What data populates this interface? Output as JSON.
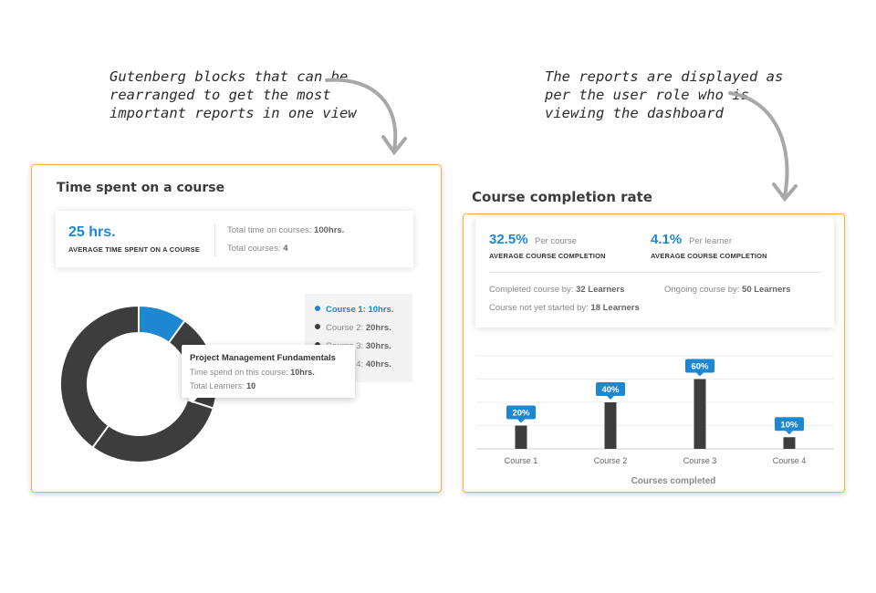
{
  "annotations": {
    "left": "Gutenberg blocks that can be\nrearranged to get the most\nimportant reports in one view",
    "right": "The reports are displayed as\nper the user role who is\nviewing the dashboard"
  },
  "time_card": {
    "title": "Time spent on a course",
    "avg_value": "25 hrs.",
    "avg_caption": "AVERAGE TIME SPENT ON A COURSE",
    "total_time_label": "Total time on courses:",
    "total_time_value": "100hrs.",
    "total_courses_label": "Total courses:",
    "total_courses_value": "4",
    "legend": [
      {
        "label": "Course 1:",
        "value": "10hrs.",
        "active": true
      },
      {
        "label": "Course 2:",
        "value": "20hrs."
      },
      {
        "label": "Course 3:",
        "value": "30hrs."
      },
      {
        "label": "Course 4:",
        "value": "40hrs."
      }
    ],
    "tooltip": {
      "title": "Project Management Fundamentals",
      "line1_label": "Time spend on this course:",
      "line1_value": "10hrs.",
      "line2_label": "Total Learners:",
      "line2_value": "10"
    },
    "donut": {
      "values": [
        10,
        20,
        30,
        40
      ],
      "colors": [
        "#1d87d2",
        "#3d3d3d",
        "#3d3d3d",
        "#3d3d3d"
      ]
    }
  },
  "completion_card": {
    "title": "Course completion rate",
    "per_course_value": "32.5%",
    "per_course_suffix": "Per course",
    "per_course_caption": "AVERAGE COURSE COMPLETION",
    "per_learner_value": "4.1%",
    "per_learner_suffix": "Per learner",
    "per_learner_caption": "AVERAGE COURSE COMPLETION",
    "completed_label": "Completed course by:",
    "completed_value": "32 Learners",
    "ongoing_label": "Ongoing course by:",
    "ongoing_value": "50 Learners",
    "not_started_label": "Course not yet started by:",
    "not_started_value": "18 Learners"
  },
  "chart_data": {
    "type": "bar",
    "categories": [
      "Course 1",
      "Course 2",
      "Course 3",
      "Course 4"
    ],
    "values": [
      20,
      40,
      60,
      10
    ],
    "data_labels": [
      "20%",
      "40%",
      "60%",
      "10%"
    ],
    "xlabel": "Courses completed",
    "ylabel": "",
    "ylim": [
      0,
      80
    ],
    "grid": true,
    "bar_color": "#3d3d3d",
    "label_color": "#1d87d2"
  },
  "colors": {
    "accent": "#1d87d2",
    "card_border": "#f1b33c",
    "dark": "#3d3d3d"
  }
}
